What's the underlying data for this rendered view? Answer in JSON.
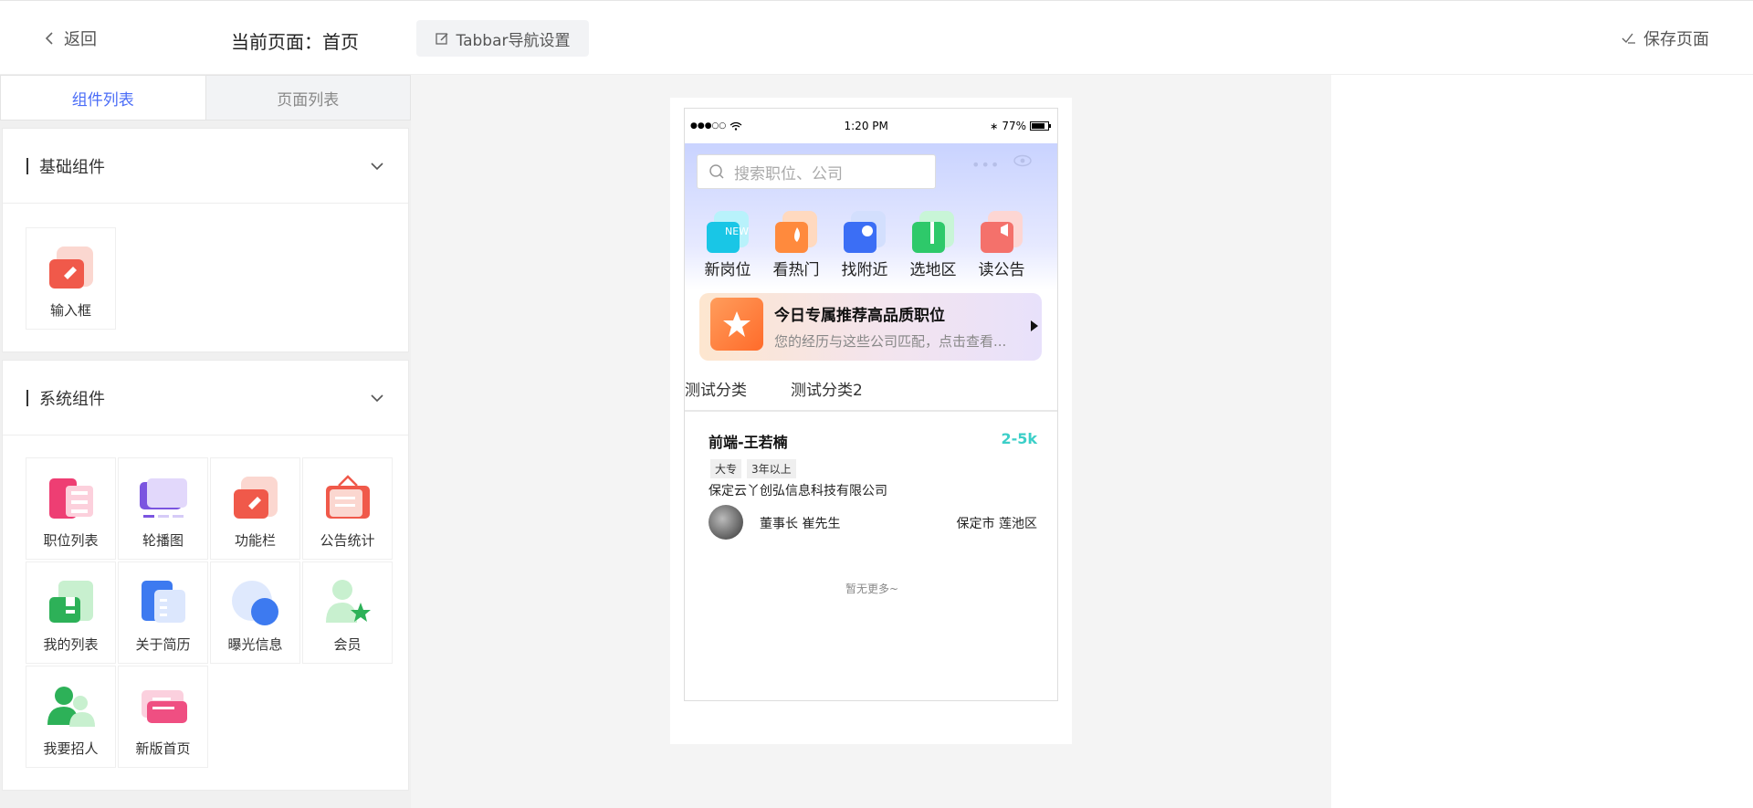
{
  "header": {
    "back_label": "返回",
    "current_page": "当前页面：首页",
    "tabbar_btn": "Tabbar导航设置",
    "save_label": "保存页面"
  },
  "left": {
    "tabs": [
      "组件列表",
      "页面列表"
    ],
    "sections": [
      {
        "title": "基础组件",
        "items": [
          {
            "label": "输入框",
            "icon": "input-icon"
          }
        ]
      },
      {
        "title": "系统组件",
        "items": [
          {
            "label": "职位列表",
            "icon": "job-list-icon"
          },
          {
            "label": "轮播图",
            "icon": "carousel-icon"
          },
          {
            "label": "功能栏",
            "icon": "function-bar-icon"
          },
          {
            "label": "公告统计",
            "icon": "notice-stats-icon"
          },
          {
            "label": "我的列表",
            "icon": "my-list-icon"
          },
          {
            "label": "关于简历",
            "icon": "resume-icon"
          },
          {
            "label": "曝光信息",
            "icon": "exposure-icon"
          },
          {
            "label": "会员",
            "icon": "member-icon"
          },
          {
            "label": "我要招人",
            "icon": "recruit-icon"
          },
          {
            "label": "新版首页",
            "icon": "new-home-icon"
          }
        ]
      }
    ]
  },
  "phone": {
    "status": {
      "signal": "●●●○○",
      "time": "1:20 PM",
      "battery": "77%"
    },
    "search_placeholder": "搜索职位、公司",
    "icons": [
      {
        "label": "新岗位",
        "badge": "NEW",
        "color": "#19c6e6"
      },
      {
        "label": "看热门",
        "color": "#ff8a3d"
      },
      {
        "label": "找附近",
        "color": "#3b6ef5"
      },
      {
        "label": "选地区",
        "color": "#2ec96a"
      },
      {
        "label": "读公告",
        "color": "#f4716b"
      }
    ],
    "banner": {
      "title": "今日专属推荐高品质职位",
      "subtitle": "您的经历与这些公司匹配，点击查看..."
    },
    "categories": [
      "测试分类",
      "测试分类2"
    ],
    "job": {
      "title": "前端-王若楠",
      "salary": "2-5k",
      "tags": [
        "大专",
        "3年以上"
      ],
      "company": "保定云丫创弘信息科技有限公司",
      "boss": "董事长 崔先生",
      "location": "保定市 莲池区"
    },
    "no_more": "暂无更多~"
  }
}
